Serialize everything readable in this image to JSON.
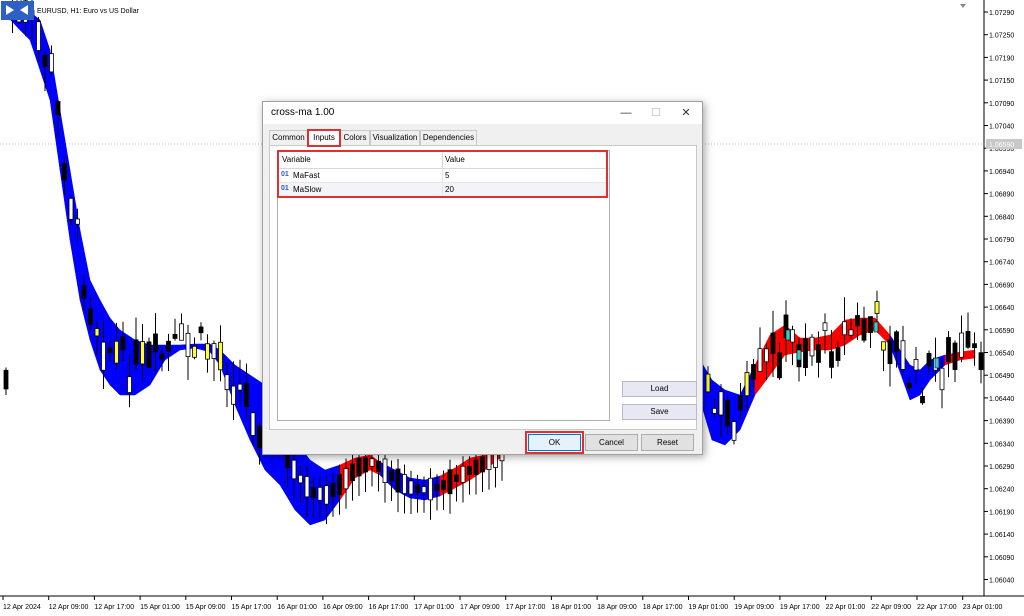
{
  "chart": {
    "title": "EURUSD, H1:  Euro vs US Dollar",
    "current_price": "1.06590",
    "price_labels": [
      "1.07290",
      "1.07250",
      "1.07190",
      "1.07150",
      "1.07090",
      "1.07040",
      "1.06990",
      "1.06940",
      "1.06890",
      "1.06840",
      "1.06790",
      "1.06740",
      "1.06690",
      "1.06640",
      "1.06590",
      "1.06540",
      "1.06490",
      "1.06440",
      "1.06390",
      "1.06340",
      "1.06290",
      "1.06240",
      "1.06190",
      "1.06140",
      "1.06090",
      "1.06040"
    ],
    "time_labels": [
      "12 Apr 2024",
      "12 Apr 09:00",
      "12 Apr 17:00",
      "15 Apr 01:00",
      "15 Apr 09:00",
      "15 Apr 17:00",
      "16 Apr 01:00",
      "16 Apr 09:00",
      "16 Apr 17:00",
      "17 Apr 01:00",
      "17 Apr 09:00",
      "17 Apr 17:00",
      "18 Apr 01:00",
      "18 Apr 09:00",
      "18 Apr 17:00",
      "19 Apr 01:00",
      "19 Apr 09:00",
      "19 Apr 17:00",
      "22 Apr 01:00",
      "22 Apr 09:00",
      "22 Apr 17:00",
      "23 Apr 01:00"
    ],
    "colors": {
      "bull_cloud": "#0000ff",
      "bear_cloud": "#ff0000",
      "candle": "#000000",
      "doji": "#ffff33",
      "cross": "#33cccc"
    }
  },
  "dialog": {
    "title": "cross-ma 1.00",
    "minimize_icon": "minimize-icon",
    "maximize_icon": "maximize-icon",
    "close_icon": "close-icon",
    "tabs": [
      {
        "label": "Common"
      },
      {
        "label": "Inputs"
      },
      {
        "label": "Colors"
      },
      {
        "label": "Visualization"
      },
      {
        "label": "Dependencies"
      }
    ],
    "active_tab": "Inputs",
    "table": {
      "headers": {
        "variable": "Variable",
        "value": "Value"
      },
      "rows": [
        {
          "type_icon": "01",
          "variable": "MaFast",
          "value": "5"
        },
        {
          "type_icon": "01",
          "variable": "MaSlow",
          "value": "20"
        }
      ]
    },
    "load_label": "Load",
    "save_label": "Save",
    "ok_label": "OK",
    "cancel_label": "Cancel",
    "reset_label": "Reset"
  }
}
